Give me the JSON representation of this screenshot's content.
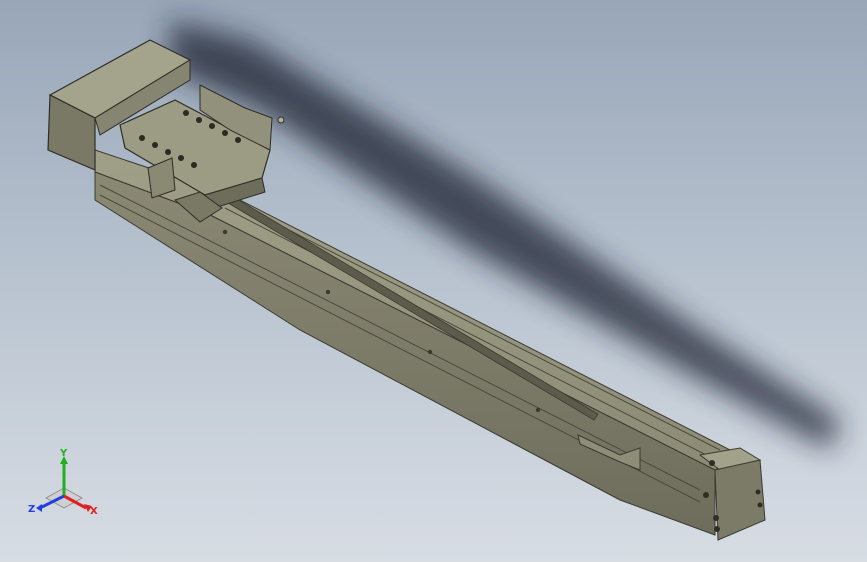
{
  "view": {
    "background_top": "#98a6b8",
    "background_bottom": "#d8dde4",
    "model_color": "#8a8a76",
    "model_dark": "#4a4a3e",
    "shadow_color": "#1c2430"
  },
  "triad": {
    "y_label": "Y",
    "z_label": "Z",
    "x_label": "X",
    "x_color": "#e02020",
    "y_color": "#20b020",
    "z_color": "#2040e0"
  }
}
